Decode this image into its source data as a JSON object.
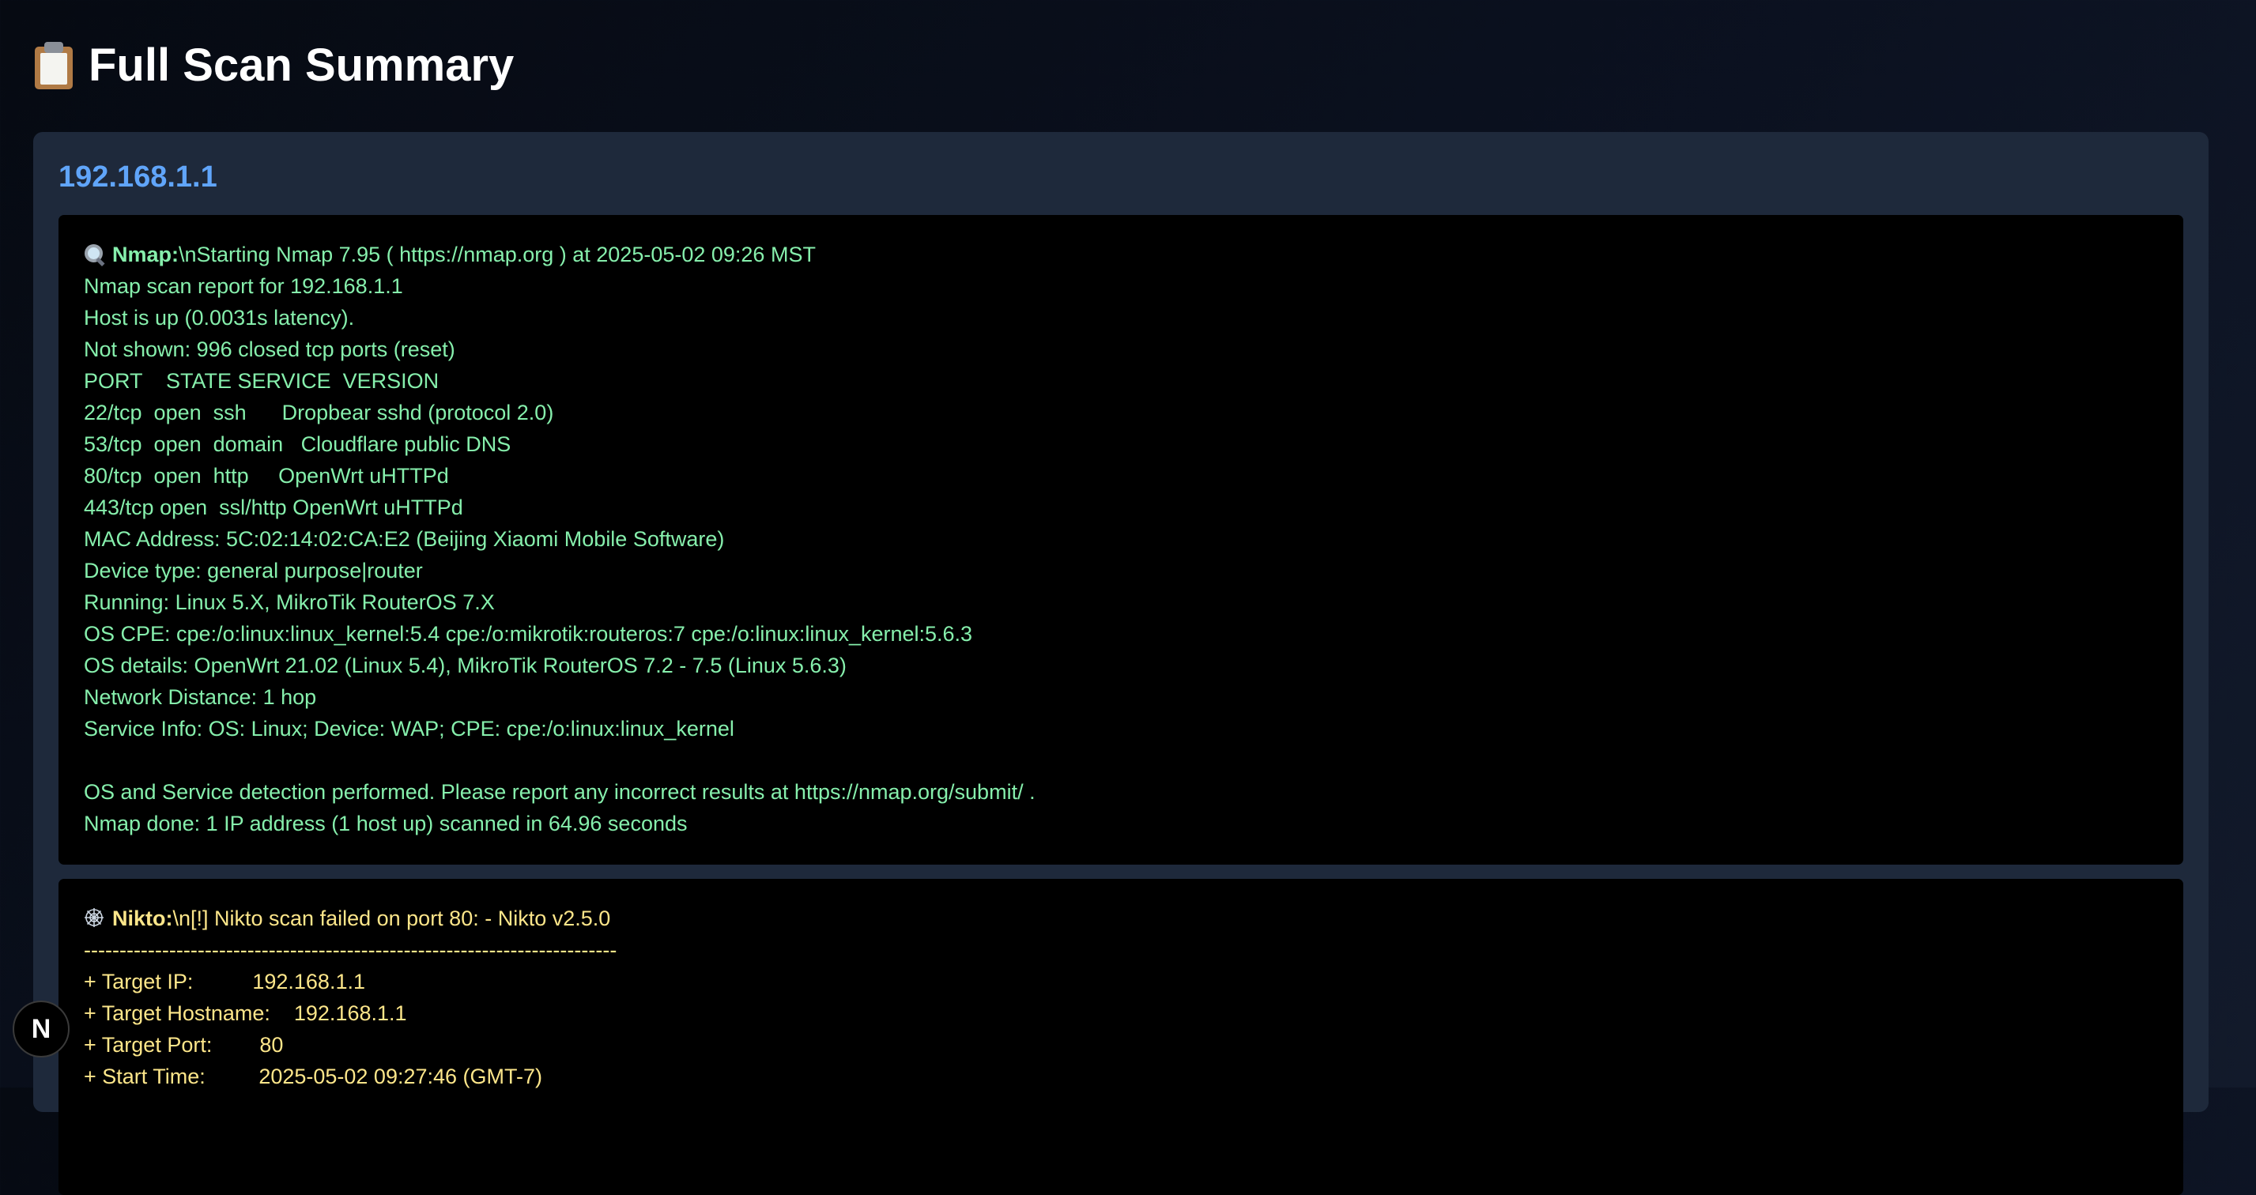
{
  "page": {
    "title": "Full Scan Summary",
    "title_icon": "clipboard-icon"
  },
  "host": {
    "ip": "192.168.1.1"
  },
  "nmap": {
    "icon": "magnifier-icon",
    "label": "Nmap:",
    "lines": [
      "\\nStarting Nmap 7.95 ( https://nmap.org ) at 2025-05-02 09:26 MST",
      "Nmap scan report for 192.168.1.1",
      "Host is up (0.0031s latency).",
      "Not shown: 996 closed tcp ports (reset)",
      "PORT    STATE SERVICE  VERSION",
      "22/tcp  open  ssh      Dropbear sshd (protocol 2.0)",
      "53/tcp  open  domain   Cloudflare public DNS",
      "80/tcp  open  http     OpenWrt uHTTPd",
      "443/tcp open  ssl/http OpenWrt uHTTPd",
      "MAC Address: 5C:02:14:02:CA:E2 (Beijing Xiaomi Mobile Software)",
      "Device type: general purpose|router",
      "Running: Linux 5.X, MikroTik RouterOS 7.X",
      "OS CPE: cpe:/o:linux:linux_kernel:5.4 cpe:/o:mikrotik:routeros:7 cpe:/o:linux:linux_kernel:5.6.3",
      "OS details: OpenWrt 21.02 (Linux 5.4), MikroTik RouterOS 7.2 - 7.5 (Linux 5.6.3)",
      "Network Distance: 1 hop",
      "Service Info: OS: Linux; Device: WAP; CPE: cpe:/o:linux:linux_kernel",
      "",
      "OS and Service detection performed. Please report any incorrect results at https://nmap.org/submit/ .",
      "Nmap done: 1 IP address (1 host up) scanned in 64.96 seconds"
    ]
  },
  "nikto": {
    "icon": "spider-icon",
    "label": "Nikto:",
    "lines": [
      "\\n[!] Nikto scan failed on port 80: - Nikto v2.5.0",
      "---------------------------------------------------------------------------",
      "+ Target IP:          192.168.1.1",
      "+ Target Hostname:    192.168.1.1",
      "+ Target Port:        80",
      "+ Start Time:         2025-05-02 09:27:46 (GMT-7)"
    ]
  },
  "dev_badge": {
    "label": "N",
    "icon": "nextjs-logo-icon"
  }
}
